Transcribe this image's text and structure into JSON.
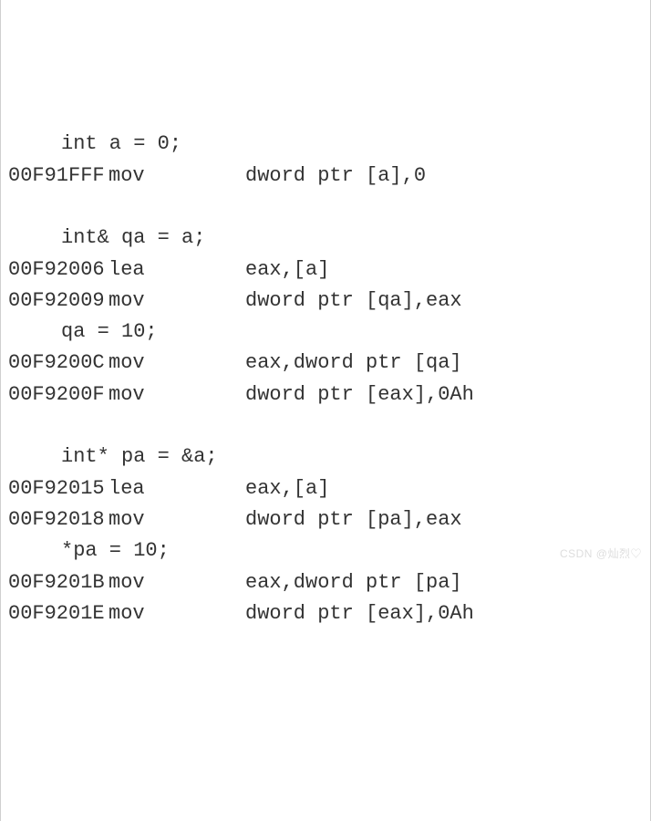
{
  "lines": [
    {
      "type": "source",
      "text": "int a = 0;"
    },
    {
      "type": "asm",
      "addr": "00F91FFF",
      "mnem": "mov",
      "ops": "dword ptr [a],0"
    },
    {
      "type": "blank"
    },
    {
      "type": "source",
      "text": "int& qa = a;"
    },
    {
      "type": "asm",
      "addr": "00F92006",
      "mnem": "lea",
      "ops": "eax,[a]"
    },
    {
      "type": "asm",
      "addr": "00F92009",
      "mnem": "mov",
      "ops": "dword ptr [qa],eax"
    },
    {
      "type": "source",
      "text": "qa = 10;"
    },
    {
      "type": "asm",
      "addr": "00F9200C",
      "mnem": "mov",
      "ops": "eax,dword ptr [qa]"
    },
    {
      "type": "asm",
      "addr": "00F9200F",
      "mnem": "mov",
      "ops": "dword ptr [eax],0Ah"
    },
    {
      "type": "blank"
    },
    {
      "type": "source",
      "text": "int* pa = &a;"
    },
    {
      "type": "asm",
      "addr": "00F92015",
      "mnem": "lea",
      "ops": "eax,[a]"
    },
    {
      "type": "asm",
      "addr": "00F92018",
      "mnem": "mov",
      "ops": "dword ptr [pa],eax"
    },
    {
      "type": "source",
      "text": "*pa = 10;"
    },
    {
      "type": "asm",
      "addr": "00F9201B",
      "mnem": "mov",
      "ops": "eax,dword ptr [pa]"
    },
    {
      "type": "asm",
      "addr": "00F9201E",
      "mnem": "mov",
      "ops": "dword ptr [eax],0Ah"
    }
  ],
  "watermark": "CSDN @灿烈♡"
}
